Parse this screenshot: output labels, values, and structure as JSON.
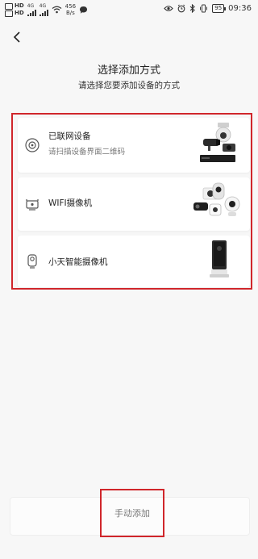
{
  "status_bar": {
    "sim1": "HD",
    "sim2": "HD",
    "network1": "4G",
    "network2": "4G",
    "net_speed_value": "456",
    "net_speed_unit": "B/s",
    "battery": "95",
    "time": "09:36",
    "icons": [
      "eye-icon",
      "alarm-icon",
      "bluetooth-icon",
      "vibrate-icon",
      "wifi-icon",
      "chat-icon"
    ]
  },
  "header": {
    "back_icon": "chevron-left-icon",
    "title": "选择添加方式",
    "subtitle": "请选择您要添加设备的方式"
  },
  "options": [
    {
      "label": "已联网设备",
      "hint": "请扫描设备界面二维码",
      "icon": "scan-circle-icon"
    },
    {
      "label": "WIFI摄像机",
      "icon": "router-icon"
    },
    {
      "label": "小天智能摄像机",
      "icon": "camera-outline-icon"
    }
  ],
  "footer": {
    "manual_add_label": "手动添加"
  },
  "colors": {
    "highlight": "#d0262b",
    "background": "#f7f7f7",
    "card": "#ffffff"
  }
}
